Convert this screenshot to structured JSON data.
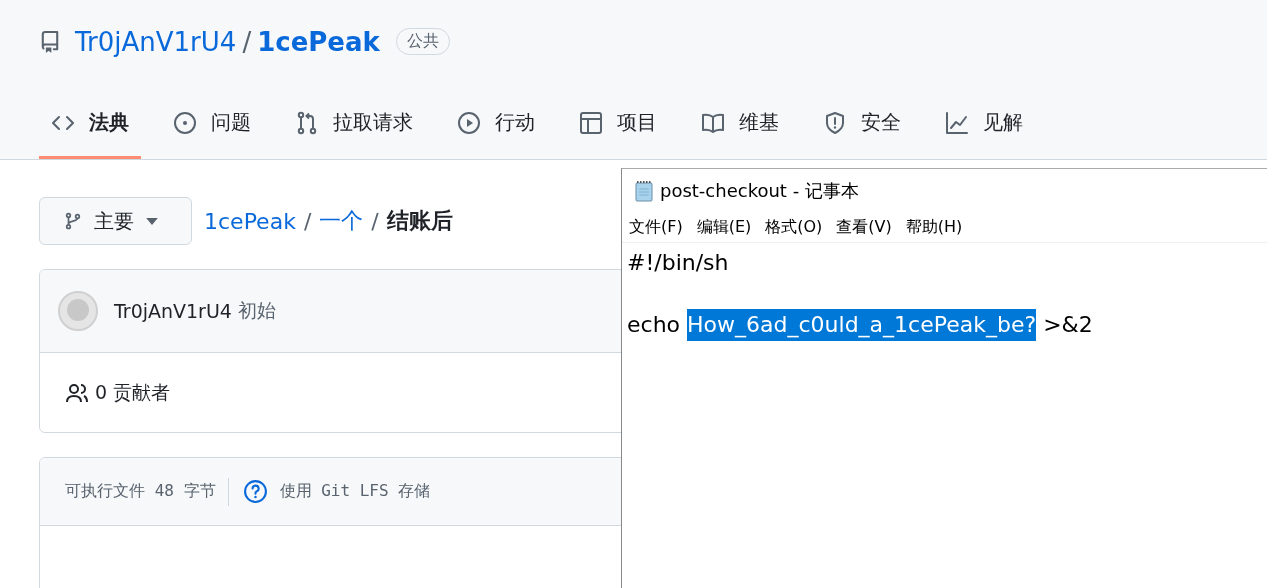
{
  "repo": {
    "owner": "Tr0jAnV1rU4",
    "separator": "/",
    "name": "1cePeak",
    "visibility": "公共"
  },
  "tabs": [
    {
      "label": "法典",
      "kind": "code",
      "selected": true
    },
    {
      "label": "问题",
      "kind": "issue",
      "selected": false
    },
    {
      "label": "拉取请求",
      "kind": "pull",
      "selected": false
    },
    {
      "label": "行动",
      "kind": "play",
      "selected": false
    },
    {
      "label": "项目",
      "kind": "table",
      "selected": false
    },
    {
      "label": "维基",
      "kind": "book",
      "selected": false
    },
    {
      "label": "安全",
      "kind": "shield",
      "selected": false
    },
    {
      "label": "见解",
      "kind": "graph",
      "selected": false
    }
  ],
  "branch": {
    "label": "主要"
  },
  "breadcrumb": {
    "links": [
      {
        "text": "1cePeak",
        "separator": "/"
      },
      {
        "text": "一个",
        "separator": "/"
      }
    ],
    "current": "结账后"
  },
  "commit": {
    "author": "Tr0jAnV1rU4",
    "message": "初始"
  },
  "contributors": "0 贡献者",
  "file_info": {
    "mode": "可执行文件 48 字节",
    "lfs": "使用 Git LFS 存储"
  },
  "notepad": {
    "title": "post-checkout - 记事本",
    "menu": [
      "文件(F)",
      "编辑(E)",
      "格式(O)",
      "查看(V)",
      "帮助(H)"
    ],
    "lines": [
      {
        "parts": [
          {
            "text": "#!/bin/sh",
            "selected": false
          }
        ]
      },
      {
        "parts": [
          {
            "text": "echo",
            "selected": false
          },
          {
            "text": "How_6ad_c0uld_a_1cePeak_be?",
            "selected": true
          },
          {
            "text": ">&2",
            "selected": false
          }
        ]
      }
    ]
  }
}
